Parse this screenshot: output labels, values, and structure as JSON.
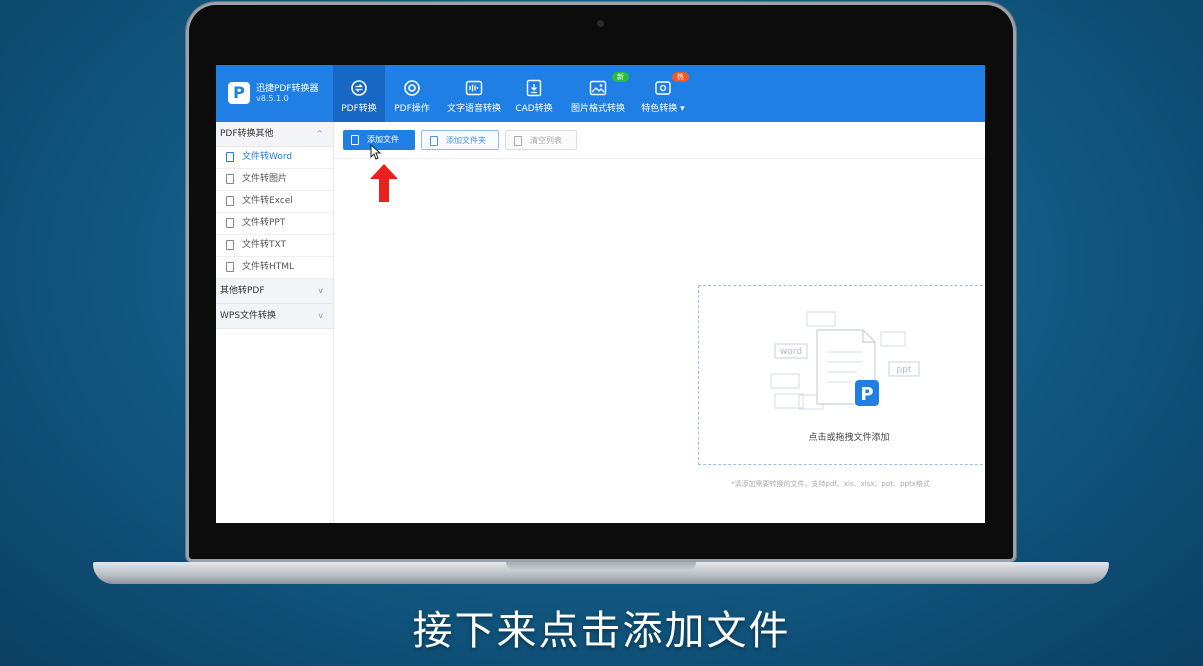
{
  "app": {
    "name": "迅捷PDF转换器",
    "version": "v8.5.1.0",
    "logo_letter": "P"
  },
  "nav": {
    "tabs": [
      {
        "label": "PDF转换",
        "icon": "convert-icon",
        "active": true
      },
      {
        "label": "PDF操作",
        "icon": "gear-circle-icon",
        "active": false
      },
      {
        "label": "文字语音转换",
        "icon": "audio-wave-icon",
        "active": false
      },
      {
        "label": "CAD转换",
        "icon": "cad-icon",
        "active": false
      },
      {
        "label": "图片格式转换",
        "icon": "image-icon",
        "active": false
      },
      {
        "label": "特色转换 ▾",
        "icon": "special-icon",
        "active": false
      }
    ],
    "badges": {
      "new": "新",
      "hot": "热"
    },
    "badge_colors": {
      "new": "#2dbb3f",
      "hot": "#f05a28"
    }
  },
  "sidebar": {
    "groups": [
      {
        "label": "PDF转换其他",
        "chevron": "^"
      },
      {
        "label": "其他转PDF",
        "chevron": "v"
      },
      {
        "label": "WPS文件转换",
        "chevron": "v"
      }
    ],
    "items": [
      {
        "label": "文件转Word",
        "active": true
      },
      {
        "label": "文件转图片",
        "active": false
      },
      {
        "label": "文件转Excel",
        "active": false
      },
      {
        "label": "文件转PPT",
        "active": false
      },
      {
        "label": "文件转TXT",
        "active": false
      },
      {
        "label": "文件转HTML",
        "active": false
      }
    ]
  },
  "toolbar": {
    "add_file": "添加文件",
    "add_folder": "添加文件夹",
    "clear_list": "清空列表"
  },
  "drop_zone": {
    "text": "点击或拖拽文件添加",
    "icon_labels": [
      "word",
      "ppt"
    ]
  },
  "hint": "*请添加需要转换的文件，支持pdf、xls、xlsx、ppt、pptx格式",
  "subtitle": "接下来点击添加文件",
  "colors": {
    "accent": "#1f7fe5",
    "header_active": "#1767c4",
    "arrow": "#e8211d"
  }
}
